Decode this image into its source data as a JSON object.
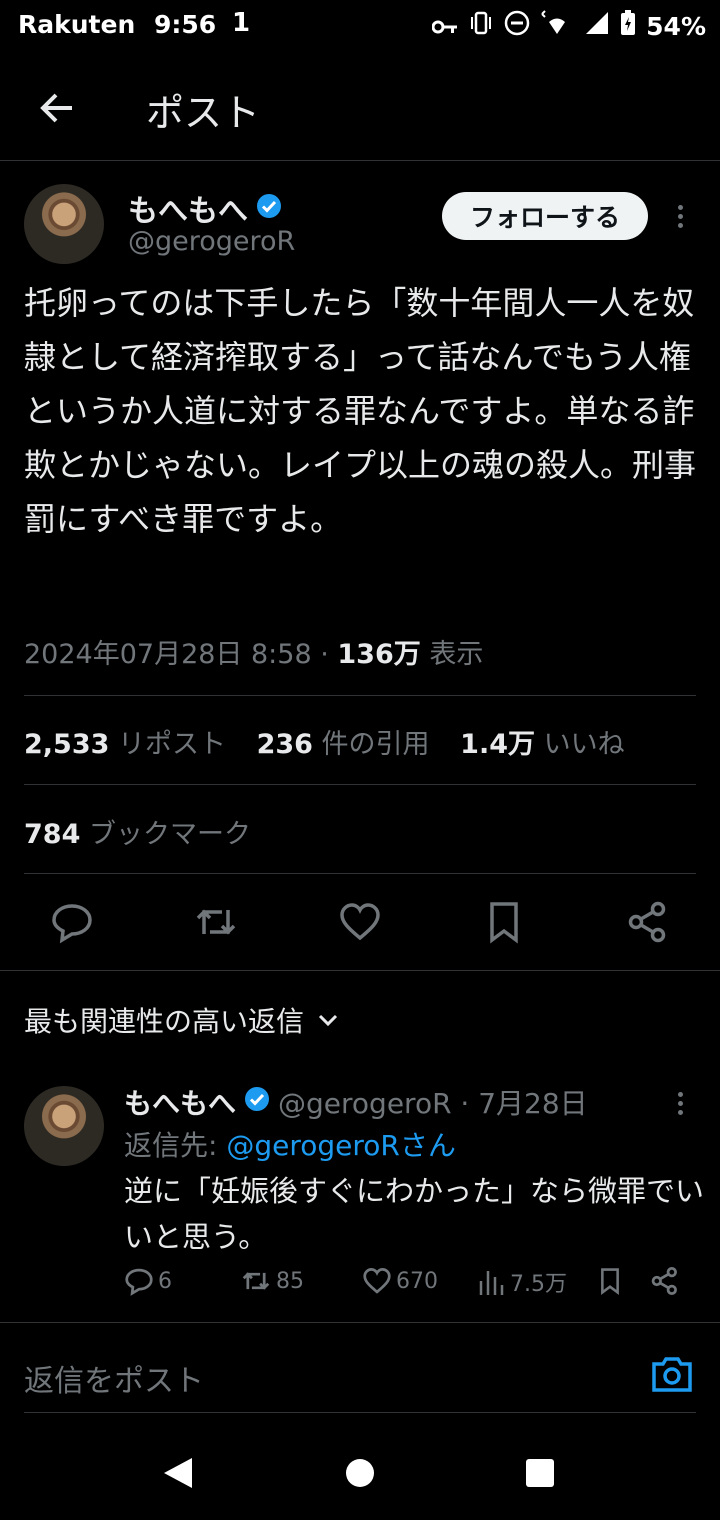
{
  "status_bar": {
    "carrier": "Rakuten",
    "time": "9:56",
    "notification": "1",
    "battery": "54%"
  },
  "header": {
    "title": "ポスト"
  },
  "post": {
    "display_name": "もへもへ",
    "handle": "@gerogeroR",
    "follow_label": "フォローする",
    "text": "托卵ってのは下手したら「数十年間人一人を奴隷として経済搾取する」って話なんでもう人権というか人道に対する罪なんですよ。単なる詐欺とかじゃない。レイプ以上の魂の殺人。刑事罰にすべき罪ですよ。",
    "timestamp": "2024年07月28日 8:58 · ",
    "views_count": "136万",
    "views_label": " 表示",
    "reposts_count": "2,533",
    "reposts_label": " リポスト",
    "quotes_count": "236",
    "quotes_label": " 件の引用",
    "likes_count": "1.4万",
    "likes_label": " いいね",
    "bookmarks_count": "784",
    "bookmarks_label": " ブックマーク"
  },
  "sort": {
    "label": "最も関連性の高い返信"
  },
  "reply": {
    "display_name": "もへもへ",
    "handle_date": "@gerogeroR · 7月28日",
    "reply_to_prefix": "返信先: ",
    "reply_to_handle": "@gerogeroRさん",
    "text": "逆に「妊娠後すぐにわかった」なら微罪でいいと思う。",
    "replies": "6",
    "reposts": "85",
    "likes": "670",
    "views": "7.5万"
  },
  "compose": {
    "placeholder": "返信をポスト"
  },
  "colors": {
    "accent": "#1d9bf0",
    "background": "#000000",
    "muted": "#71767b"
  }
}
